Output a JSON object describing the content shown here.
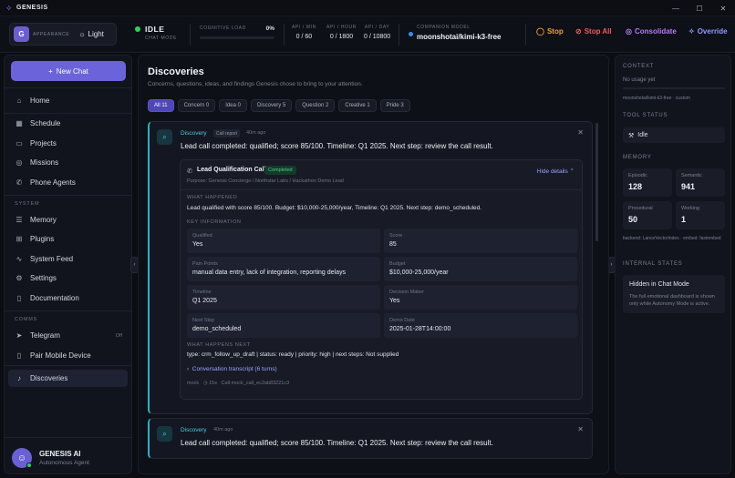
{
  "titlebar": {
    "app_name": "GENESIS",
    "minimize": "—",
    "maximize": "☐",
    "close": "✕"
  },
  "topbar": {
    "appearance_badge": "G",
    "appearance_label": "APPEARANCE",
    "theme_toggle": "Light",
    "status": "IDLE",
    "status_mode": "CHAT MODE",
    "cognitive_load_label": "COGNITIVE LOAD",
    "cognitive_load_value": "0%",
    "cognitive_load_fraction": 0,
    "api_min_label": "API / MIN",
    "api_min_value": "0 / 60",
    "api_hour_label": "API / HOUR",
    "api_hour_value": "0 / 1800",
    "api_day_label": "API / DAY",
    "api_day_value": "0 / 10800",
    "companion_label": "COMPANION MODEL",
    "companion_value": "moonshotai/kimi-k3-free",
    "stop": "Stop",
    "stop_all": "Stop All",
    "consolidate": "Consolidate",
    "override": "Override",
    "colors": {
      "stop": "#f0a23a",
      "stop_all": "#ef5c5c",
      "consolidate": "#b57cf5",
      "override": "#8f9bff",
      "idle_dot": "#2fd15a"
    }
  },
  "sidebar": {
    "new_chat": "New Chat",
    "items": [
      {
        "label": "Home",
        "icon": "home-icon"
      },
      {
        "label": "Schedule",
        "icon": "calendar-icon"
      },
      {
        "label": "Projects",
        "icon": "folder-icon"
      },
      {
        "label": "Missions",
        "icon": "target-icon"
      },
      {
        "label": "Phone Agents",
        "icon": "phone-icon"
      }
    ],
    "system_label": "SYSTEM",
    "system_items": [
      {
        "label": "Memory",
        "icon": "database-icon"
      },
      {
        "label": "Plugins",
        "icon": "plug-icon"
      },
      {
        "label": "System Feed",
        "icon": "activity-icon"
      },
      {
        "label": "Settings",
        "icon": "gear-icon"
      },
      {
        "label": "Documentation",
        "icon": "book-icon"
      }
    ],
    "comms_label": "COMMS",
    "comms_items": [
      {
        "label": "Telegram",
        "icon": "send-icon",
        "badge": "Off"
      },
      {
        "label": "Pair Mobile Device",
        "icon": "mobile-icon"
      }
    ],
    "active_item": {
      "label": "Discoveries",
      "icon": "bell-icon"
    },
    "user_name": "GENESIS AI",
    "user_role": "Autonomous Agent"
  },
  "main": {
    "title": "Discoveries",
    "subtitle": "Concerns, questions, ideas, and findings Genesis chose to bring to your attention.",
    "filters": [
      "All 11",
      "Concern 0",
      "Idea 0",
      "Discovery 5",
      "Question 2",
      "Creative 1",
      "Pride 3"
    ],
    "card1": {
      "type": "Discovery",
      "tag": "Call report",
      "time": "40m ago",
      "title": "Lead call completed: qualified; score 85/100. Timeline: Q1 2025. Next step: review the call result.",
      "call_title": "Lead Qualification Call",
      "call_status": "Completed",
      "purpose": "Purpose: Genesis Concierge / Northstar Labs / Hackathon Demo Lead",
      "hide_details": "Hide details",
      "what_happened_label": "WHAT HAPPENED",
      "what_happened": "Lead qualified with score 85/100. Budget: $10,000-25,000/year, Timeline: Q1 2025. Next step: demo_scheduled.",
      "key_info_label": "KEY INFORMATION",
      "key_info": [
        {
          "k": "Qualified",
          "v": "Yes"
        },
        {
          "k": "Score",
          "v": "85"
        },
        {
          "k": "Pain Points",
          "v": "manual data entry, lack of integration, reporting delays"
        },
        {
          "k": "Budget",
          "v": "$10,000-25,000/year"
        },
        {
          "k": "Timeline",
          "v": "Q1 2025"
        },
        {
          "k": "Decision Maker",
          "v": "Yes"
        },
        {
          "k": "Next Step",
          "v": "demo_scheduled"
        },
        {
          "k": "Demo Date",
          "v": "2025-01-28T14:00:00"
        }
      ],
      "next_label": "WHAT HAPPENS NEXT",
      "next": "type: crm_follow_up_draft | status: ready | priority: high | next steps: Not supplied",
      "transcript": "Conversation transcript (6 turns)",
      "meta_mock": "mock",
      "meta_duration": "15s",
      "meta_call": "Call mock_call_ec2ab83221c3"
    },
    "card2": {
      "type": "Discovery",
      "time": "40m ago",
      "title": "Lead call completed: qualified; score 85/100. Timeline: Q1 2025. Next step: review the call result."
    }
  },
  "right": {
    "context_label": "CONTEXT",
    "context_text": "No usage yet",
    "model_text": "moonshotai/kimi-k3-free · custom",
    "tool_label": "TOOL STATUS",
    "tool_value": "Idle",
    "memory_label": "MEMORY",
    "memory": [
      {
        "k": "Episodic",
        "v": "128"
      },
      {
        "k": "Semantic",
        "v": "941"
      },
      {
        "k": "Procedural",
        "v": "50"
      },
      {
        "k": "Working",
        "v": "1"
      }
    ],
    "backend": "backend: LanceVectorIndex · embed: fastembed",
    "internal_label": "INTERNAL STATES",
    "hidden_title": "Hidden in Chat Mode",
    "hidden_desc": "The full emotional dashboard is shown only while Autonomy Mode is active."
  }
}
